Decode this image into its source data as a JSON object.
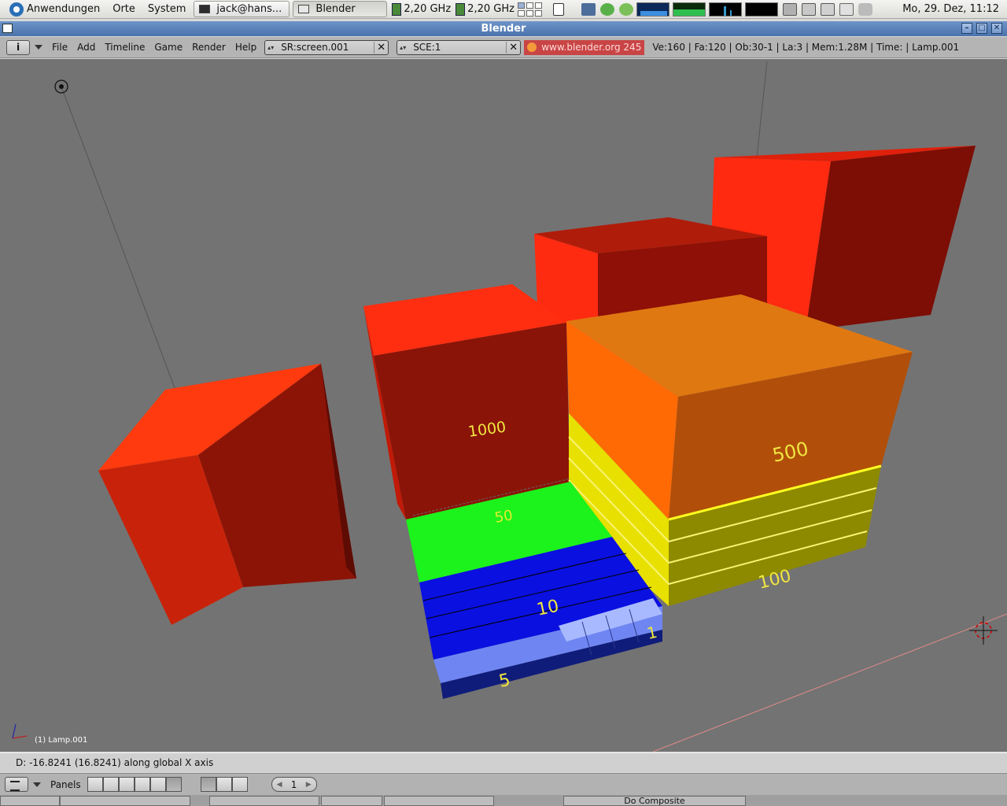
{
  "panel": {
    "apps": "Anwendungen",
    "places": "Orte",
    "system": "System",
    "tasks": [
      "jack@hans...",
      "Blender"
    ],
    "cpu1": "2,20 GHz",
    "cpu2": "2,20 GHz",
    "clock": "Mo, 29. Dez, 11:12"
  },
  "window": {
    "title": "Blender"
  },
  "header": {
    "menus": [
      "File",
      "Add",
      "Timeline",
      "Game",
      "Render",
      "Help"
    ],
    "screen": "SR:screen.001",
    "scene": "SCE:1",
    "url": "www.blender.org 245",
    "stats": "Ve:160 | Fa:120 | Ob:30-1 | La:3  | Mem:1.28M  | Time: | Lamp.001"
  },
  "viewport": {
    "object_label": "(1) Lamp.001",
    "block_labels": [
      "1000",
      "500",
      "50",
      "100",
      "10",
      "1",
      "5"
    ]
  },
  "status": {
    "text": "D: -16.8241 (16.8241) along global X axis"
  },
  "buttons": {
    "panels_label": "Panels",
    "frame": "1",
    "composite": "Do Composite"
  }
}
